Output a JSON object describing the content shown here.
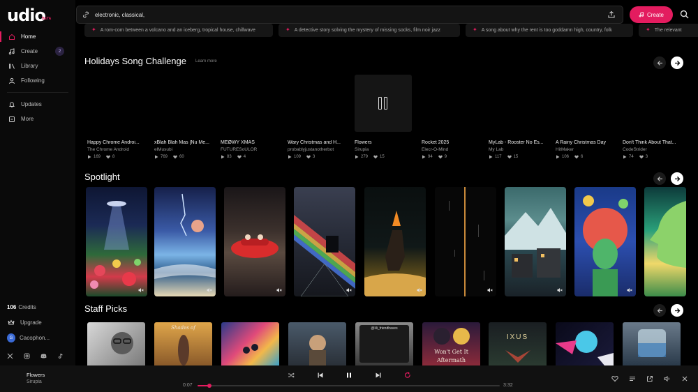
{
  "app": {
    "logo": "udio",
    "logo_badge": "BETA"
  },
  "sidebar": {
    "items": [
      {
        "label": "Home",
        "icon": "home-icon",
        "active": true
      },
      {
        "label": "Create",
        "icon": "music-note-icon",
        "badge": "2"
      },
      {
        "label": "Library",
        "icon": "library-icon"
      },
      {
        "label": "Following",
        "icon": "user-icon"
      }
    ],
    "secondary": [
      {
        "label": "Updates",
        "icon": "bell-icon"
      },
      {
        "label": "More",
        "icon": "more-icon"
      }
    ],
    "credits_value": "106",
    "credits_label": "Credits",
    "upgrade_label": "Upgrade",
    "user_initial": "G",
    "user_name": "Cacophon...",
    "social": [
      "x-icon",
      "instagram-icon",
      "discord-icon",
      "tiktok-icon"
    ]
  },
  "search": {
    "value": "electronic, classical,"
  },
  "create_button": "Create",
  "prompts": [
    "A rom-com between a volcano and an iceberg, tropical house, chillwave",
    "A detective story solving the mystery of missing socks, film noir jazz",
    "A song about why the rent is too goddamn high, country, folk",
    "The relevant"
  ],
  "holidays": {
    "title": "Holidays Song Challenge",
    "learn_more": "Learn more",
    "songs": [
      {
        "title": "Happy Chrome Androi...",
        "artist": "The Chrome Android",
        "plays": "169",
        "likes": "8"
      },
      {
        "title": "xBlah Blah Mas [Nu Me...",
        "artist": "elMusubi",
        "plays": "769",
        "likes": "60"
      },
      {
        "title": "MEØWY XMAS",
        "artist": "FUTURESoULOR",
        "plays": "83",
        "likes": "4"
      },
      {
        "title": "Wary Christmas and H...",
        "artist": "probablyjustanotherbot",
        "plays": "109",
        "likes": "3"
      },
      {
        "title": "Flowers",
        "artist": "Sirupia",
        "plays": "279",
        "likes": "15",
        "playing": true
      },
      {
        "title": "Rocket 2025",
        "artist": "Elecr-O-Mind",
        "plays": "94",
        "likes": "9"
      },
      {
        "title": "MyLab - Rooster No Es...",
        "artist": "My Lab",
        "plays": "117",
        "likes": "15"
      },
      {
        "title": "A Rainy Christmas Day",
        "artist": "HitMaker",
        "plays": "106",
        "likes": "6"
      },
      {
        "title": "Don't Think About That...",
        "artist": "CodeStrider",
        "plays": "74",
        "likes": "3"
      }
    ]
  },
  "spotlight": {
    "title": "Spotlight",
    "cards": 9
  },
  "staff_picks": {
    "title": "Staff Picks",
    "cover_texts": [
      "Shades of",
      "@lili_friendhaves",
      "Won't Get It",
      "Aftermath",
      "IXUS"
    ]
  },
  "player": {
    "title": "Flowers",
    "artist": "Sirupia",
    "elapsed": "0:07",
    "duration": "3:32",
    "progress_fraction": 0.04
  },
  "colors": {
    "accent": "#e31c5f",
    "background": "#000000",
    "surface": "#111111"
  }
}
